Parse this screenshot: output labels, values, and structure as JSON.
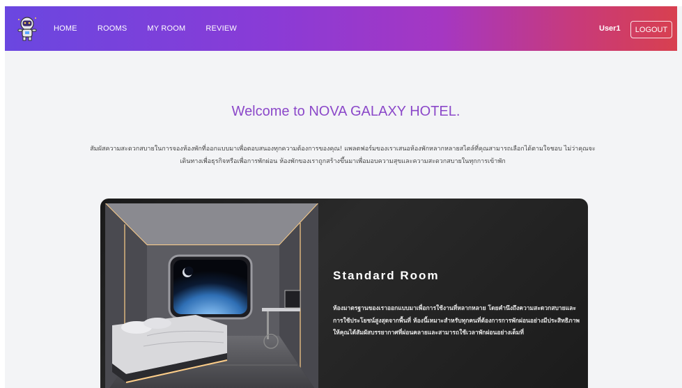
{
  "nav": {
    "items": [
      {
        "label": "HOME"
      },
      {
        "label": "ROOMS"
      },
      {
        "label": "MY ROOM"
      },
      {
        "label": "REVIEW"
      }
    ],
    "user": "User1",
    "logout_label": "LOGOUT",
    "logo_icon": "astronaut-icon"
  },
  "hero": {
    "title": "Welcome to NOVA GALAXY HOTEL.",
    "description": "สัมผัสความสะดวกสบายในการจองห้องพักที่ออกแบบมาเพื่อตอบสนองทุกความต้องการของคุณ! แพลตฟอร์มของเราเสนอห้องพักหลากหลายสไตล์ที่คุณสามารถเลือกได้ตามใจชอบ ไม่ว่าคุณจะเดินทางเพื่อธุรกิจหรือเพื่อการพักผ่อน ห้องพักของเราถูกสร้างขึ้นมาเพื่อมอบความสุขและความสะดวกสบายในทุกการเข้าพัก"
  },
  "room": {
    "title": "Standard Room",
    "description": "ห้องมาตรฐานของเราออกแบบมาเพื่อการใช้งานที่หลากหลาย โดยคำนึงถึงความสะดวกสบายและการใช้ประโยชน์สูงสุดจากพื้นที่ ห้องนี้เหมาะสำหรับทุกคนที่ต้องการการพักผ่อนอย่างมีประสิทธิภาพ ให้คุณได้สัมผัสบรรยากาศที่ผ่อนคลายและสามารถใช้เวลาพักผ่อนอย่างเต็มที่",
    "image_icon": "space-room-image"
  },
  "colors": {
    "nav_gradient_start": "#6a47e0",
    "nav_gradient_end": "#d8404f",
    "title_color": "#8b48c9",
    "card_bg": "#1a1a1a"
  }
}
